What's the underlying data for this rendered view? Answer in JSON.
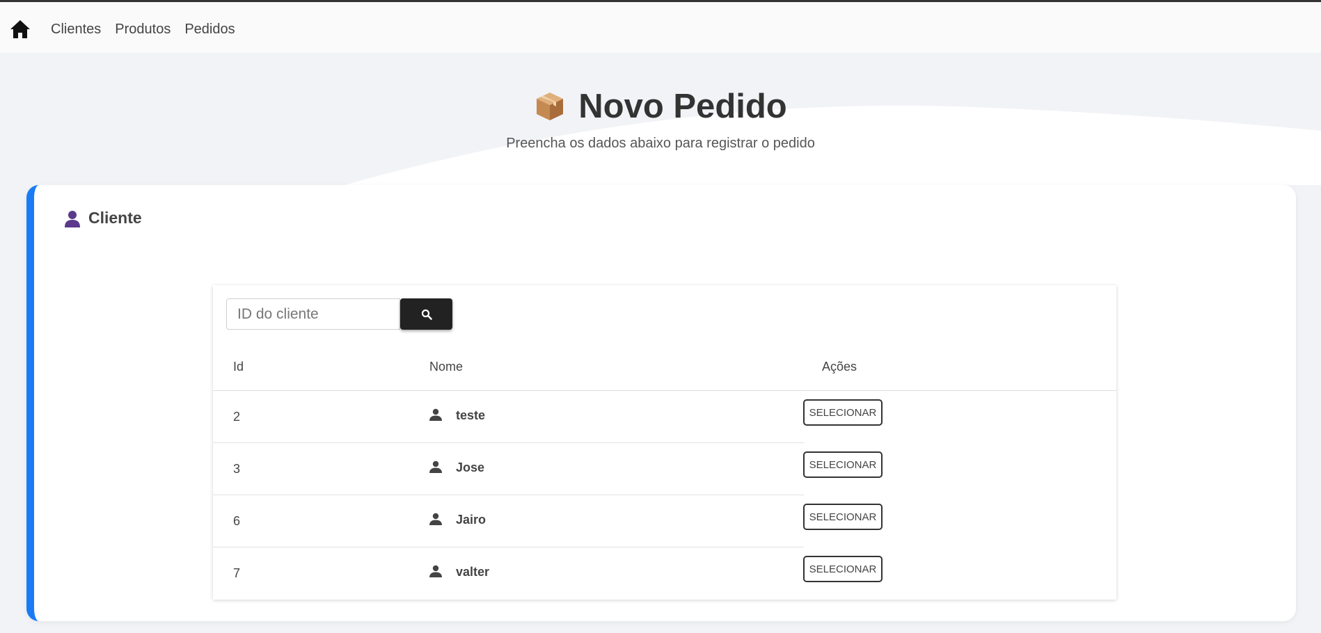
{
  "nav": {
    "home_icon": "home-icon",
    "items": [
      "Clientes",
      "Produtos",
      "Pedidos"
    ]
  },
  "hero": {
    "icon": "package-icon",
    "title": "Novo Pedido",
    "subtitle": "Preencha os dados abaixo para registrar o pedido"
  },
  "card": {
    "icon": "person-icon",
    "title": "Cliente",
    "accent_color": "#1a7cf5"
  },
  "search": {
    "placeholder": "ID do cliente",
    "value": "",
    "button_icon": "search-icon"
  },
  "table": {
    "headers": [
      "Id",
      "Nome",
      "Ações"
    ],
    "rows": [
      {
        "id": "2",
        "name": "teste",
        "action": "SELECIONAR"
      },
      {
        "id": "3",
        "name": "Jose",
        "action": "SELECIONAR"
      },
      {
        "id": "6",
        "name": "Jairo",
        "action": "SELECIONAR"
      },
      {
        "id": "7",
        "name": "valter",
        "action": "SELECIONAR"
      }
    ]
  }
}
